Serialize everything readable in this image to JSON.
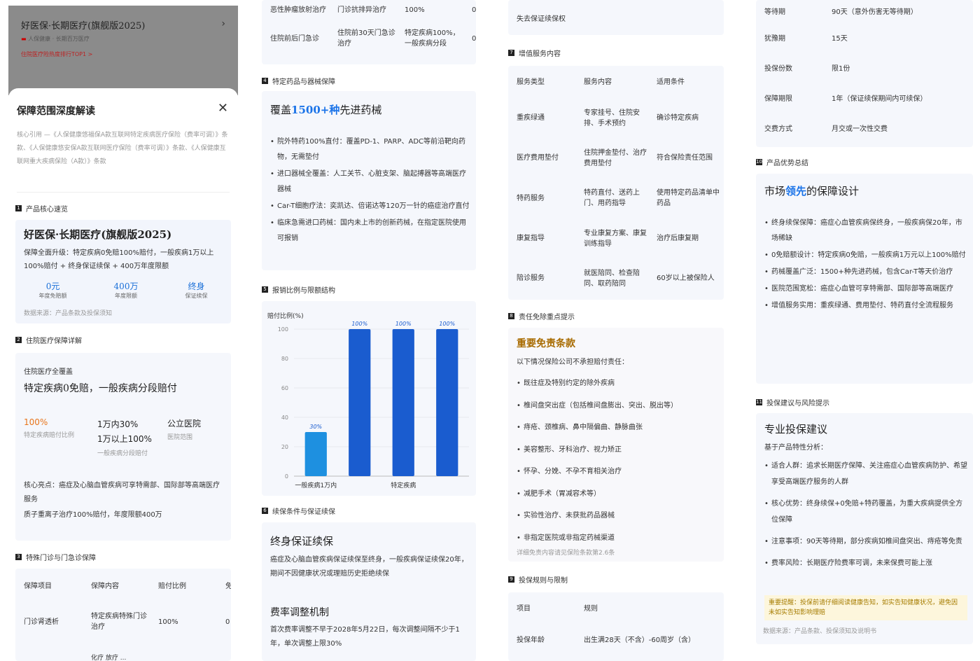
{
  "col1": {
    "app_title": "好医保·长期医疗(旗舰版2025)",
    "app_sub": "人保健康 · 长期百万医疗",
    "app_badge": "住院医疗险热度排行TOP1 >",
    "sheet_title": "保障范围深度解读",
    "cite": "核心引用 —《人保健康悠福保A款互联网特定疾病医疗保险（费率可调）》条款、《人保健康悠安保A款互联网医疗保险（费率可调）》条款、《人保健康互联网重大疾病保险（A款）》条款",
    "s1": "产品核心速览",
    "s1_num": "1",
    "overview_title": "好医保·长期医疗(旗舰版2025)",
    "overview_desc": "保障全面升级：特定疾病0免赔100%赔付，一般疾病1万以上100%赔付 + 终身保证续保 + 400万年度限额",
    "stats": [
      {
        "v": "0元",
        "l": "年度免赔额"
      },
      {
        "v": "400万",
        "l": "年度限额"
      },
      {
        "v": "终身",
        "l": "保证续保"
      }
    ],
    "source1": "数据来源：产品条款及投保须知",
    "s2": "住院医疗保障详解",
    "s2_num": "2",
    "inpatient_label": "住院医疗全覆盖",
    "inpatient_title": "特定疾病0免赔，一般疾病分段赔付",
    "grid": [
      {
        "v": "100%",
        "l": "特定疾病赔付比例"
      },
      {
        "v": "1万内30%\n1万以上100%",
        "l": "一般疾病分段赔付"
      },
      {
        "v": "公立医院",
        "l": "医院范围"
      }
    ],
    "highlight1": "核心亮点：癌症及心脑血管疾病可享特需部、国际部等高端医疗服务",
    "highlight2": "质子重离子治疗100%赔付，年度限额400万",
    "s3": "特殊门诊与门急诊保障",
    "s3_num": "3",
    "t3_head": [
      "保障项目",
      "保障内容",
      "赔付比例",
      "免"
    ],
    "t3_rows": [
      [
        "门诊肾透析",
        "特定疾病特殊门诊治疗",
        "100%",
        "0"
      ]
    ],
    "t3_partial": "化疗 放疗 ..."
  },
  "col2": {
    "t3_top": [
      "恶性肿瘤放射治疗",
      "门诊抗排异治疗",
      "100%",
      "0"
    ],
    "t3_row2": [
      "住院前后门急诊",
      "住院前30天门急诊治疗",
      "特定疾病100%，一般疾病分段",
      "0"
    ],
    "s4": "特定药品与器械保障",
    "s4_num": "4",
    "drug_title_a": "覆盖",
    "drug_title_b": "1500+种",
    "drug_title_c": "先进药械",
    "drugs": [
      "院外特药100%直付：覆盖PD-1、PARP、ADC等前沿靶向药物，无需垫付",
      "进口器械全覆盖：人工关节、心脏支架、脑起搏器等高端医疗器械",
      "Car-T细胞疗法：奕凯达、倍诺达等120万一针的癌症治疗直付",
      "临床急需进口药械：国内未上市的创新药械，在指定医院使用可报销"
    ],
    "s5": "报销比例与限额结构",
    "s5_num": "5",
    "s6": "续保条件与保证续保",
    "s6_num": "6",
    "renew_title": "终身保证续保",
    "renew_desc": "癌症及心脑血管疾病保证续保至终身，一般疾病保证续保20年，期间不因健康状况或理赔历史拒绝续保",
    "rate_title": "费率调整机制",
    "rate_desc": "首次费率调整不早于2028年5月22日，每次调整间隔不少于1年，单次调整上限30%"
  },
  "chart_data": {
    "type": "bar",
    "ylabel": "赔付比例(%)",
    "ylim": [
      0,
      100
    ],
    "yticks": [
      0,
      20,
      40,
      60,
      80,
      100
    ],
    "categories": [
      "一般疾病1万内",
      "",
      "特定疾病",
      ""
    ],
    "values": [
      30,
      100,
      100,
      100
    ],
    "labels": [
      "30%",
      "100%",
      "100%",
      "100%"
    ],
    "colors": [
      "#1e90e0",
      "#1a5ccf",
      "#1a5ccf",
      "#1a5ccf"
    ],
    "grid": true
  },
  "col3": {
    "top_text": "失去保证续保权",
    "s7": "增值服务内容",
    "s7_num": "7",
    "t7_head": [
      "服务类型",
      "服务内容",
      "适用条件"
    ],
    "t7_rows": [
      [
        "重疾绿通",
        "专家挂号、住院安排、手术预约",
        "确诊特定疾病"
      ],
      [
        "医疗费用垫付",
        "住院押金垫付、治疗费用垫付",
        "符合保险责任范围"
      ],
      [
        "特药服务",
        "特药直付、送药上门、用药指导",
        "使用特定药品清单中药品"
      ],
      [
        "康复指导",
        "专业康复方案、康复训练指导",
        "治疗后康复期"
      ],
      [
        "陪诊服务",
        "就医陪同、检查陪同、取药陪同",
        "60岁以上被保险人"
      ]
    ],
    "s8": "责任免除重点提示",
    "s8_num": "8",
    "exclusion_title": "重要免责条款",
    "exclusion_intro": "以下情况保险公司不承担赔付责任：",
    "exclusions": [
      "既往症及特别约定的除外疾病",
      "椎间盘突出症（包括椎间盘膨出、突出、脱出等）",
      "痔疮、颈椎病、鼻中隔偏曲、静脉曲张",
      "美容整形、牙科治疗、视力矫正",
      "怀孕、分娩、不孕不育相关治疗",
      "减肥手术（胃减容术等）",
      "实验性治疗、未获批药品器械",
      "非指定医院或非指定药械渠道"
    ],
    "exclusion_note": "详细免责内容请见保险条款第2.6条",
    "s9": "投保规则与限制",
    "s9_num": "9",
    "t9_head": [
      "项目",
      "规则"
    ],
    "t9_rows": [
      [
        "投保年龄",
        "出生满28天（不含）-60周岁（含）"
      ]
    ]
  },
  "col4": {
    "t9_rows": [
      [
        "等待期",
        "90天（意外伤害无等待期）"
      ],
      [
        "犹豫期",
        "15天"
      ],
      [
        "投保份数",
        "限1份"
      ],
      [
        "保障期限",
        "1年（保证续保期间内可续保）"
      ],
      [
        "交费方式",
        "月交或一次性交费"
      ]
    ],
    "s10": "产品优势总结",
    "s10_num": "10",
    "adv_title_a": "市场",
    "adv_title_b": "领先",
    "adv_title_c": "的保障设计",
    "advs": [
      "终身续保保障：癌症心血管疾病保终身，一般疾病保20年，市场稀缺",
      "0免赔额设计：特定疾病0免赔，一般疾病1万元以上100%赔付",
      "药械覆盖广泛：1500+种先进药械，包含Car-T等天价治疗",
      "医院范围宽松：癌症心血管可享特需部、国际部等高端医疗",
      "增值服务实用：重疾绿通、费用垫付、特药直付全流程服务"
    ],
    "s11": "投保建议与风险提示",
    "s11_num": "11",
    "sugg_title": "专业投保建议",
    "sugg_intro": "基于产品特性分析：",
    "suggs": [
      "适合人群：追求长期医疗保障、关注癌症心血管疾病防护、希望享受高端医疗服务的人群",
      "核心优势：终身续保+0免赔+特药覆盖，为重大疾病提供全方位保障",
      "注意事项：90天等待期，部分疾病如椎间盘突出、痔疮等免责",
      "费率风险：长期医疗险费率可调，未来保费可能上涨"
    ],
    "warning": "重要提醒：投保前请仔细阅读健康告知，如实告知健康状况，避免因未如实告知影响理赔",
    "source": "数据来源：产品条款、投保须知及说明书"
  }
}
